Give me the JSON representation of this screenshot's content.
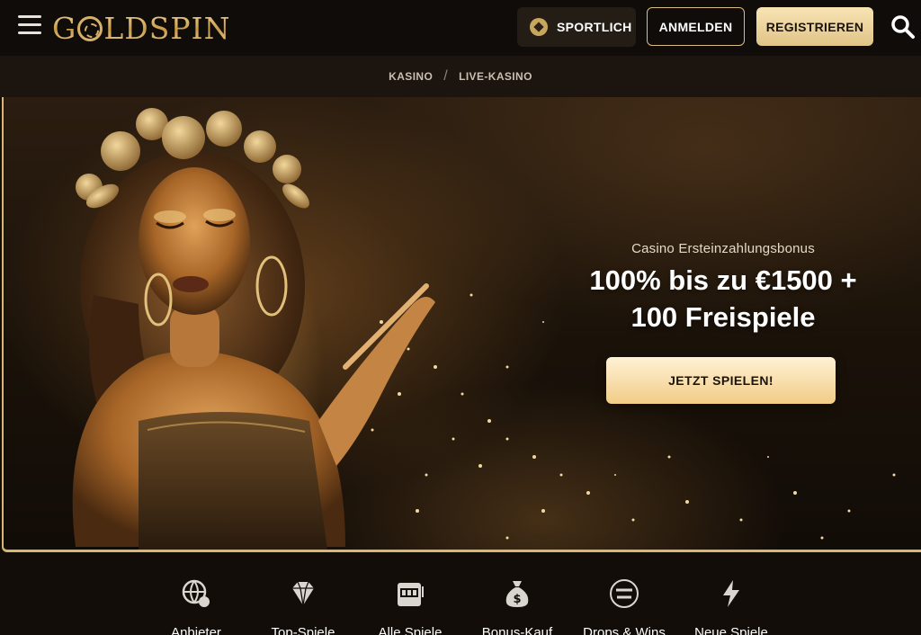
{
  "header": {
    "logo_text": "GOLDSPIN",
    "sport_label": "SPORTLICH",
    "login_label": "ANMELDEN",
    "register_label": "REGISTRIEREN",
    "menu_icon": "hamburger-icon",
    "search_icon": "search-icon"
  },
  "breadcrumb": {
    "items": [
      "KASINO",
      "LIVE-KASINO"
    ],
    "separator": "/"
  },
  "hero": {
    "subtitle": "Casino Ersteinzahlungsbonus",
    "title_line1": "100% bis zu €1500 +",
    "title_line2": "100 Freispiele",
    "cta_label": "JETZT SPIELEN!"
  },
  "categories": [
    {
      "label": "Anbieter",
      "icon": "globe-clover-icon"
    },
    {
      "label": "Top-Spiele",
      "icon": "diamond-icon"
    },
    {
      "label": "Alle Spiele",
      "icon": "slot-machine-icon"
    },
    {
      "label": "Bonus-Kauf",
      "icon": "money-bag-icon"
    },
    {
      "label": "Drops & Wins",
      "icon": "drops-wins-icon"
    },
    {
      "label": "Neue Spiele",
      "icon": "lightning-icon"
    }
  ],
  "colors": {
    "gold_accent": "#d8b772",
    "header_bg": "#0f0c09",
    "crumb_bg": "#1c150f"
  }
}
